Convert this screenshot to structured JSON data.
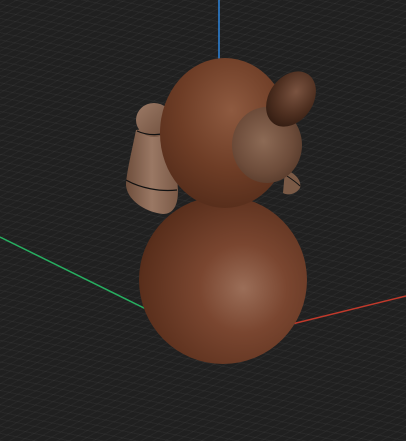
{
  "viewport": {
    "background_color": "#202020",
    "grid_visible": true
  },
  "axes": {
    "x_axis_color": "#c0392b",
    "y_axis_color": "#27ae60",
    "z_axis_color": "#2e86de"
  },
  "model": {
    "object": "bear-figure",
    "body_color": "#6b3b24",
    "snout_color": "#7a5a45",
    "ear_color": "#4a2c1c",
    "arm_color": "#8a6a55"
  }
}
